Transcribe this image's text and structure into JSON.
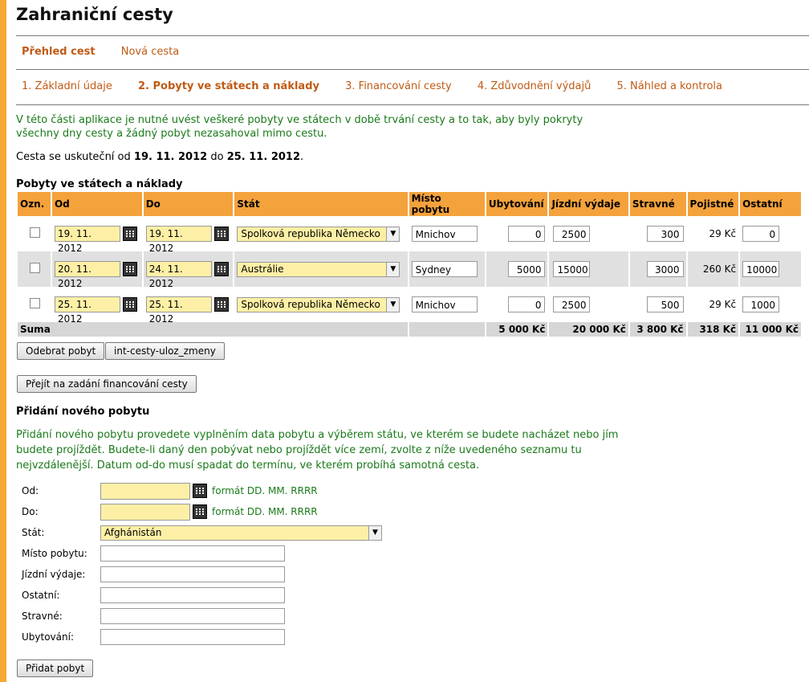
{
  "title": "Zahraniční cesty",
  "nav": [
    {
      "label": "Přehled cest",
      "active": true
    },
    {
      "label": "Nová cesta",
      "active": false
    }
  ],
  "steps": [
    {
      "label": "1. Základní údaje",
      "active": false
    },
    {
      "label": "2. Pobyty ve státech a náklady",
      "active": true
    },
    {
      "label": "3. Financování cesty",
      "active": false
    },
    {
      "label": "4. Zdůvodnění výdajů",
      "active": false
    },
    {
      "label": "5. Náhled a kontrola",
      "active": false
    }
  ],
  "info_text": "V této části aplikace je nutné uvést veškeré pobyty ve státech v době trvání cesty a to tak, aby byly pokryty všechny dny cesty a žádný pobyt nezasahoval mimo cestu.",
  "trip": {
    "prefix": "Cesta se uskuteční od",
    "from": "19. 11. 2012",
    "mid": "do",
    "to": "25. 11. 2012",
    "suffix": "."
  },
  "stays_title": "Pobyty ve státech a náklady",
  "columns": [
    "Ozn.",
    "Od",
    "Do",
    "Stát",
    "Místo pobytu",
    "Ubytování",
    "Jízdní výdaje",
    "Stravné",
    "Pojistné",
    "Ostatní"
  ],
  "rows": [
    {
      "from": "19. 11. 2012",
      "to": "19. 11. 2012",
      "state": "Spolková republika Německo",
      "place": "Mnichov",
      "accommodation": "0",
      "travel": "2500",
      "meals": "300",
      "insurance": "29 Kč",
      "other": "0"
    },
    {
      "from": "20. 11. 2012",
      "to": "24. 11. 2012",
      "state": "Austrálie",
      "place": "Sydney",
      "accommodation": "5000",
      "travel": "15000",
      "meals": "3000",
      "insurance": "260 Kč",
      "other": "10000"
    },
    {
      "from": "25. 11. 2012",
      "to": "25. 11. 2012",
      "state": "Spolková republika Německo",
      "place": "Mnichov",
      "accommodation": "0",
      "travel": "2500",
      "meals": "500",
      "insurance": "29 Kč",
      "other": "1000"
    }
  ],
  "sum": {
    "label": "Suma",
    "accommodation": "5 000 Kč",
    "travel": "20 000 Kč",
    "meals": "3 800 Kč",
    "insurance": "318 Kč",
    "other": "11 000 Kč"
  },
  "buttons": {
    "remove": "Odebrat pobyt",
    "save": "int-cesty-uloz_zmeny",
    "next": "Přejít na zadání financování cesty",
    "add": "Přidat pobyt"
  },
  "add_title": "Přidání nového pobytu",
  "add_text": "Přidání nového pobytu provedete vyplněním data pobytu a výběrem státu, ve kterém se budete nacházet nebo jím budete projíždět. Budete-li daný den pobývat nebo projíždět více zemí, zvolte z níže uvedeného seznamu tu nejvzdálenější. Datum od-do musí spadat do termínu, ve kterém probíhá samotná cesta.",
  "form": {
    "from_label": "Od:",
    "to_label": "Do:",
    "date_hint": "formát DD. MM. RRRR",
    "state_label": "Stát:",
    "state_value": "Afghánistán",
    "place_label": "Místo pobytu:",
    "travel_label": "Jízdní výdaje:",
    "other_label": "Ostatní:",
    "meals_label": "Stravné:",
    "accommodation_label": "Ubytování:"
  },
  "colors": {
    "accent": "#f4a23c",
    "link": "#c05a14",
    "info_green": "#1a7a1a",
    "input_yellow": "#fdf0a6"
  }
}
